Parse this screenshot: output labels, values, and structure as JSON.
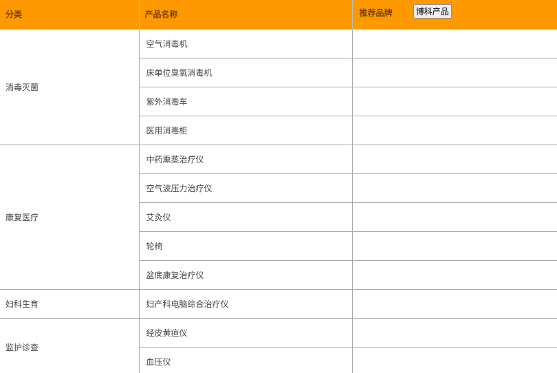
{
  "header": {
    "category": "分类",
    "product_name": "产品名称",
    "brand": "推荐品牌",
    "brand_button": "博科产品"
  },
  "groups": [
    {
      "category": "消毒灭菌",
      "products": [
        "空气消毒机",
        "床单位臭氧消毒机",
        "紫外消毒车",
        "医用消毒柜"
      ]
    },
    {
      "category": "康复医疗",
      "products": [
        "中药熏蒸治疗仪",
        "空气波压力治疗仪",
        "艾灸仪",
        "轮椅",
        "盆底康复治疗仪"
      ]
    },
    {
      "category": "妇科生育",
      "products": [
        "妇产科电脑综合治疗仪"
      ]
    },
    {
      "category": "监护诊查",
      "products": [
        "经皮黄疸仪",
        "血压仪"
      ]
    }
  ],
  "colors": {
    "header_bg": "#ff9900",
    "header_text": "#7a4400",
    "border": "#aaaaaa"
  }
}
